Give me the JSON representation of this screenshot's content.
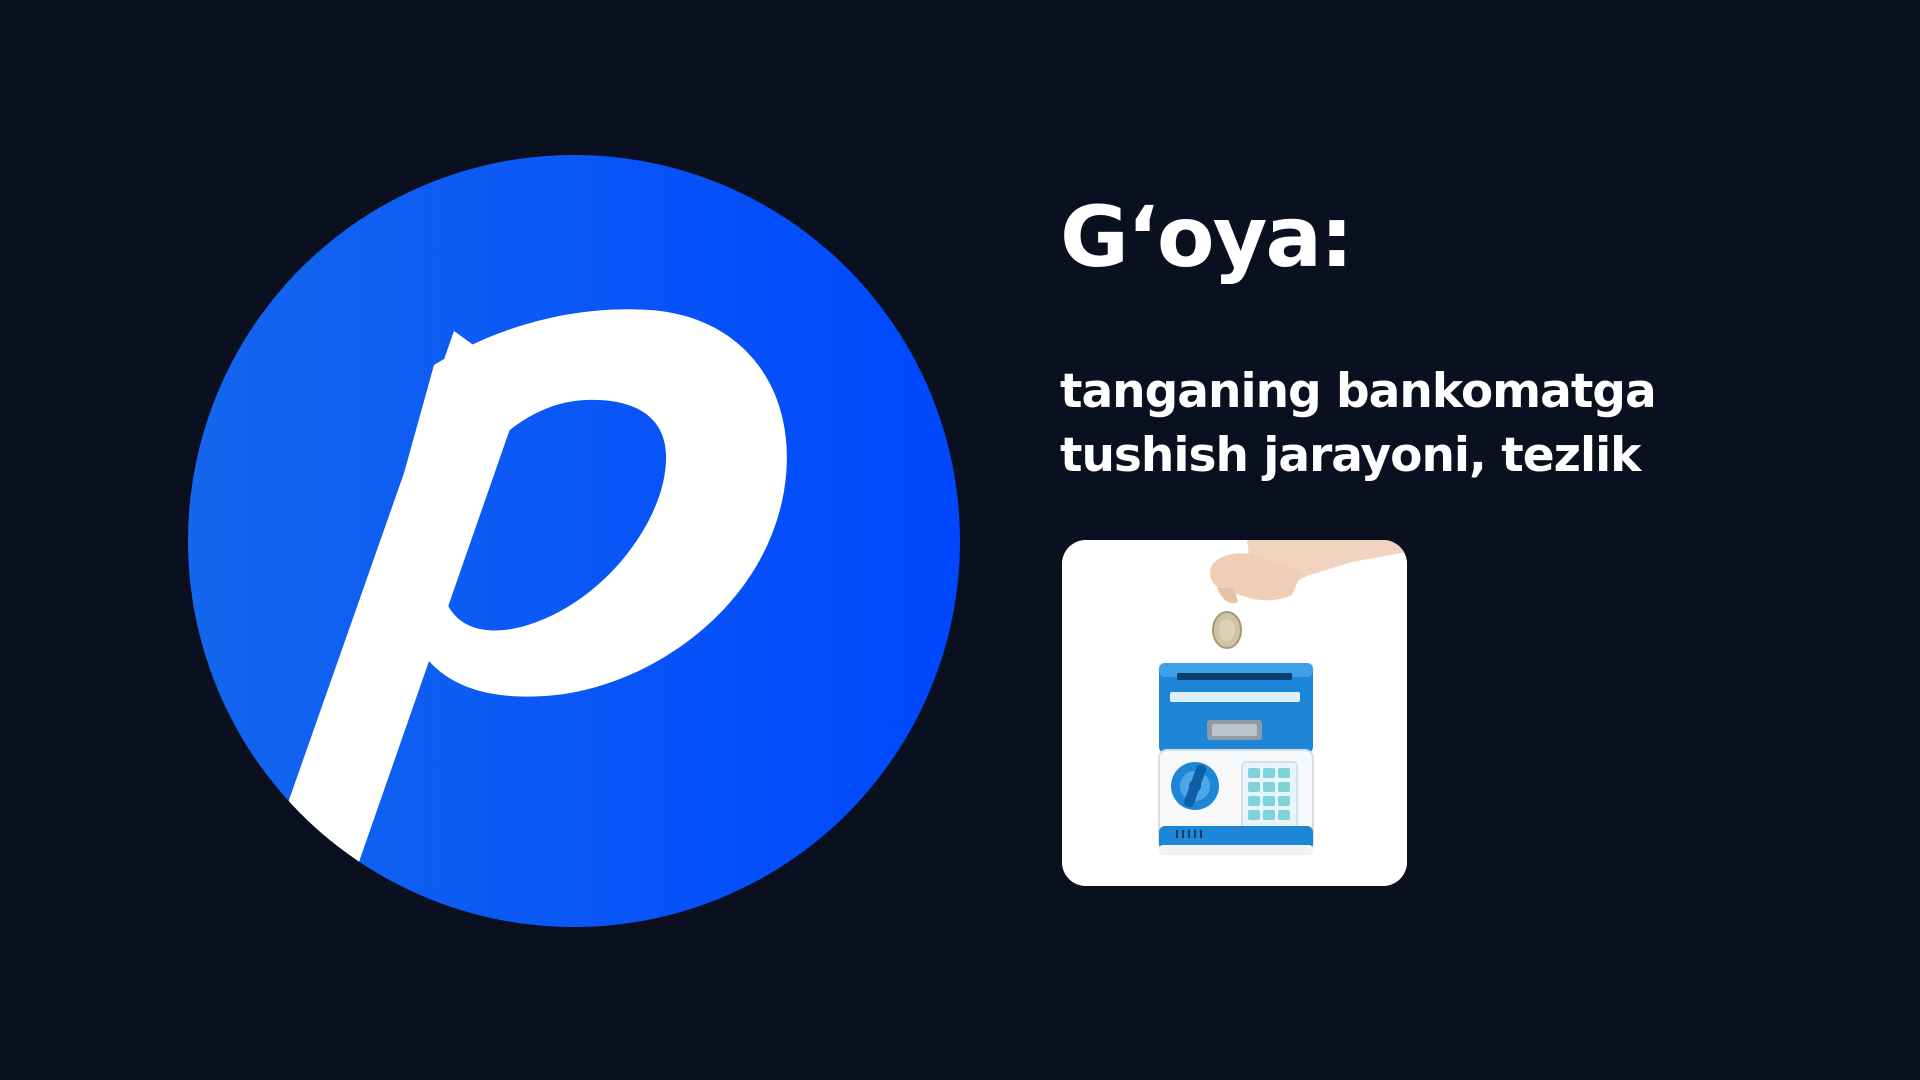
{
  "slide": {
    "title": "G‘oya:",
    "description_lines": [
      "tanganing bankomatga",
      "tushish jarayoni, tezlik"
    ]
  },
  "logo": {
    "icon": "letter-p-circle-logo",
    "gradient_start": "#1467ee",
    "gradient_end": "#0047ff",
    "glyph_color": "#ffffff"
  },
  "photo": {
    "icon": "coin-bank-atm-photo",
    "subject": "hand dropping coin into blue and white toy ATM money box"
  },
  "colors": {
    "background": "#0b1020",
    "text": "#ffffff",
    "accent": "#0a4bff"
  }
}
